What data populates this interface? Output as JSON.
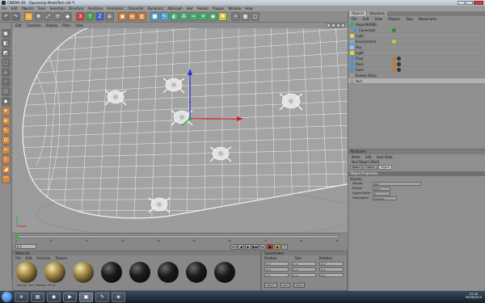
{
  "window": {
    "title": "CINEMA 4D - [Spaceship-ModelTest.c4d *]"
  },
  "menubar": [
    "File",
    "Edit",
    "Objects",
    "Tools",
    "Selection",
    "Structure",
    "Functions",
    "Animation",
    "Character",
    "Dynamics",
    "MoGraph",
    "Hair",
    "Render",
    "Plugins",
    "Window",
    "Help"
  ],
  "viewport": {
    "menu": [
      "Edit",
      "Cameras",
      "Display",
      "Filter",
      "View"
    ]
  },
  "timeline": {
    "ticks": [
      "0",
      "10",
      "20",
      "30",
      "40",
      "50",
      "60",
      "70",
      "80",
      "90"
    ],
    "frame": "0 F"
  },
  "materials": {
    "title": "Materials",
    "menu": [
      "File",
      "Edit",
      "Function",
      "Texture"
    ],
    "items": [
      "Mat",
      "Mat",
      "Mat",
      "Mat",
      "Mat",
      "Mat",
      "Mat",
      "Mat"
    ],
    "footer": "Azimuth: 35.7°   Altitude: 7.6°  W"
  },
  "coordinates": {
    "title": "Coordinates",
    "columns": [
      "Position",
      "Size",
      "Rotation"
    ],
    "rows": [
      [
        "0 m",
        "0 m",
        "H 0°"
      ],
      [
        "0 m",
        "0 m",
        "P 0°"
      ],
      [
        "0 m",
        "0 m",
        "B 0°"
      ]
    ],
    "mode": "Object",
    "size_mode": "Size",
    "apply": "Apply"
  },
  "object_manager": {
    "tabs": [
      "Objects",
      "Structure"
    ],
    "menu": [
      "File",
      "Edit",
      "View",
      "Objects",
      "Tags",
      "Bookmarks"
    ],
    "items": [
      {
        "name": "HyperNURBS"
      },
      {
        "name": "Connector"
      },
      {
        "name": "Light"
      },
      {
        "name": "Environment"
      },
      {
        "name": "Sky"
      },
      {
        "name": "Light"
      },
      {
        "name": "Floor"
      },
      {
        "name": "Base"
      },
      {
        "name": "Ruler"
      },
      {
        "name": "Enemy Ships"
      },
      {
        "name": "Null"
      }
    ]
  },
  "attributes": {
    "title": "Attributes",
    "menu": [
      "Mode",
      "Edit",
      "User Data"
    ],
    "object": "Null Object [Null]",
    "tabs": [
      "Basic",
      "Coord.",
      "Object"
    ],
    "section": "Object Properties",
    "subsection": "Display",
    "props": [
      {
        "label": "Display",
        "value": "Dot"
      },
      {
        "label": "Radius",
        "value": "10 m"
      },
      {
        "label": "Aspect Ratio",
        "value": "1"
      },
      {
        "label": "Orientation",
        "value": "Camera"
      }
    ]
  },
  "taskbar": {
    "time": "02:28",
    "date": "09/08/2010",
    "apps": [
      "IE",
      "Folder",
      "Chrome",
      "Media",
      "Cinema4D",
      "Paint",
      "Net"
    ]
  },
  "colors": {
    "viewport_bg": "#9c9c9c",
    "cage": "#ffffff",
    "axis_x": "#d22222",
    "axis_y": "#2a2ad8",
    "axis_z": "#22aa22",
    "accent": "#ff8c00"
  }
}
